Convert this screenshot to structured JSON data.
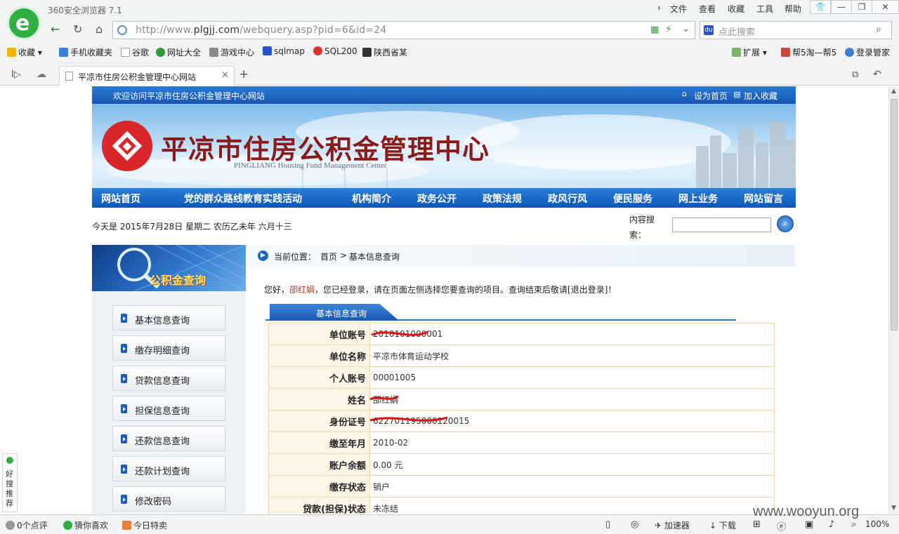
{
  "browser": {
    "title": "360安全浏览器 7.1",
    "menu": [
      "文件",
      "查看",
      "收藏",
      "工具",
      "帮助"
    ],
    "url_prefix": "http://www.",
    "url_domain": "plgjj.com",
    "url_rest": "/webquery.asp?pid=6&id=24",
    "search_placeholder": "点此搜索",
    "favorites": [
      "收藏",
      "手机收藏夹",
      "谷歌",
      "网址大全",
      "游戏中心",
      "sqlmap",
      "SQL200",
      "陕西省某"
    ],
    "right_tools": [
      "扩展",
      "帮5淘—帮5",
      "登录管家"
    ],
    "tab_title": "平凉市住房公积金管理中心网站",
    "status": {
      "comments": "0个点评",
      "guess": "猜你喜欢",
      "special": "今日特卖",
      "accelerator": "加速器",
      "download": "下载",
      "zoom": "100%"
    },
    "side_widget": "好搜推荐",
    "watermark": "www.wooyun.org"
  },
  "site": {
    "welcome": "欢迎访问平凉市住房公积金管理中心网站",
    "set_home": "设为首页",
    "add_fav": "加入收藏",
    "banner_title": "平凉市住房公积金管理中心",
    "banner_subtitle": "PINGLIANG Housing Fund Management Center",
    "nav": [
      "网站首页",
      "党的群众路线教育实践活动",
      "机构简介",
      "政务公开",
      "政策法规",
      "政风行风",
      "便民服务",
      "网上业务",
      "网站留言"
    ],
    "date_text": "今天是 2015年7月28日 星期二 农历乙未年 六月十三",
    "content_search_label": "内容搜索：",
    "side_header": "公积金查询",
    "side_menu": [
      "基本信息查询",
      "缴存明细查询",
      "贷款信息查询",
      "担保信息查询",
      "还款信息查询",
      "还款计划查询",
      "修改密码"
    ],
    "crumb_label": "当前位置：",
    "crumb_home": "首页",
    "crumb_current": "基本信息查询",
    "greeting_pre": "您好，",
    "greeting_name": "邵红娟",
    "greeting_post": "，您已经登录，请在页面左侧选择您要查询的项目。查询结束后敬请[退出登录]！",
    "section_tab": "基本信息查询",
    "rows": [
      {
        "k": "单位账号",
        "v": "2010101000001"
      },
      {
        "k": "单位名称",
        "v": "平凉市体育运动学校"
      },
      {
        "k": "个人账号",
        "v": "00001005"
      },
      {
        "k": "姓名",
        "v": "邵红娟"
      },
      {
        "k": "身份证号",
        "v": "622701195000120015"
      },
      {
        "k": "缴至年月",
        "v": "2010-02"
      },
      {
        "k": "账户余额",
        "v": "0.00 元"
      },
      {
        "k": "缴存状态",
        "v": "销户"
      },
      {
        "k": "贷款(担保)状态",
        "v": "未冻结"
      }
    ]
  }
}
